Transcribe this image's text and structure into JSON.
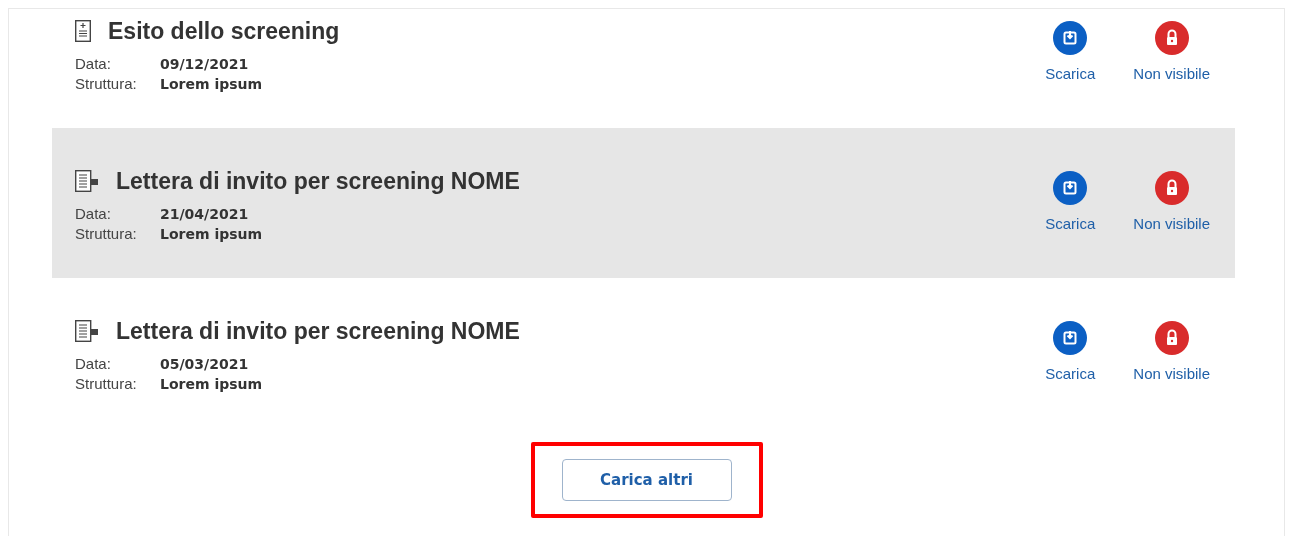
{
  "documents": [
    {
      "kind": "result",
      "title": "Esito dello screening",
      "selected": false,
      "date_label": "Data:",
      "date": "09/12/2021",
      "facility_label": "Struttura:",
      "facility": "Lorem ipsum",
      "actions": [
        {
          "kind": "download",
          "label": "Scarica"
        },
        {
          "kind": "locked",
          "label": "Non visibile"
        }
      ]
    },
    {
      "kind": "letter",
      "title": "Lettera di invito per screening NOME",
      "selected": true,
      "date_label": "Data:",
      "date": "21/04/2021",
      "facility_label": "Struttura:",
      "facility": "Lorem ipsum",
      "actions": [
        {
          "kind": "download",
          "label": "Scarica"
        },
        {
          "kind": "locked",
          "label": "Non visibile"
        }
      ]
    },
    {
      "kind": "letter",
      "title": "Lettera di invito per screening NOME",
      "selected": false,
      "date_label": "Data:",
      "date": "05/03/2021",
      "facility_label": "Struttura:",
      "facility": "Lorem ipsum",
      "actions": [
        {
          "kind": "download",
          "label": "Scarica"
        },
        {
          "kind": "locked",
          "label": "Non visibile"
        }
      ]
    }
  ],
  "load_more": {
    "label": "Carica altri",
    "highlighted": true
  }
}
